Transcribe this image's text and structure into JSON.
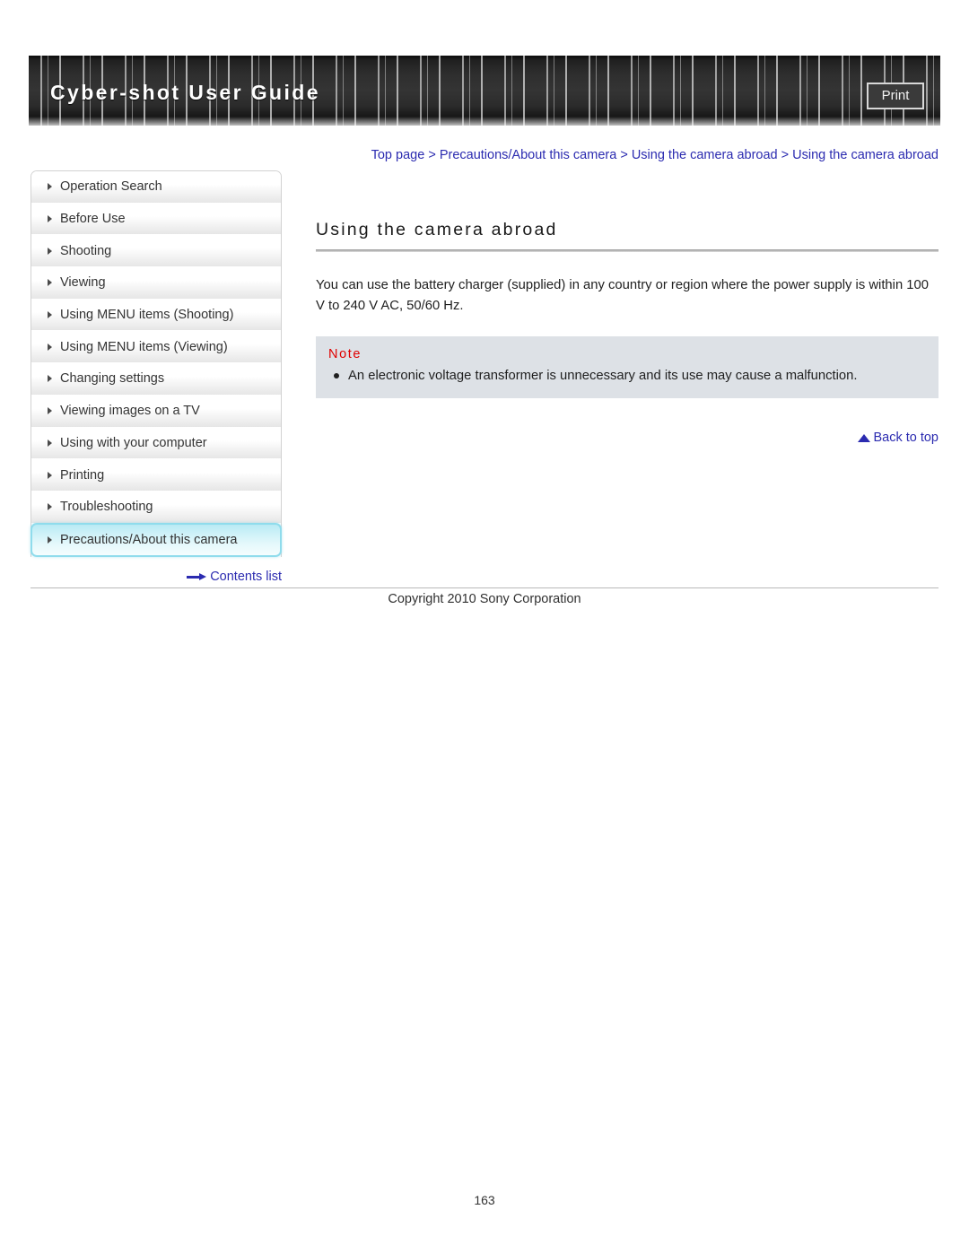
{
  "header": {
    "title": "Cyber-shot User Guide",
    "print_label": "Print"
  },
  "breadcrumb": {
    "full_text": "Top page > Precautions/About this camera > Using the camera abroad > Using the camera abroad",
    "items": [
      "Top page",
      "Precautions/About this camera",
      "Using the camera abroad",
      "Using the camera abroad"
    ],
    "separator": ">",
    "link_color": "#2b2bb0"
  },
  "sidebar": {
    "items": [
      {
        "label": "Operation Search",
        "selected": false
      },
      {
        "label": "Before Use",
        "selected": false
      },
      {
        "label": "Shooting",
        "selected": false
      },
      {
        "label": "Viewing",
        "selected": false
      },
      {
        "label": "Using MENU items (Shooting)",
        "selected": false
      },
      {
        "label": "Using MENU items (Viewing)",
        "selected": false
      },
      {
        "label": "Changing settings",
        "selected": false
      },
      {
        "label": "Viewing images on a TV",
        "selected": false
      },
      {
        "label": "Using with your computer",
        "selected": false
      },
      {
        "label": "Printing",
        "selected": false
      },
      {
        "label": "Troubleshooting",
        "selected": false
      },
      {
        "label": "Precautions/About this camera",
        "selected": true
      }
    ],
    "contents_list_label": "Contents list",
    "selected_bg": "#cdf1f8",
    "selected_border": "#8fdcec"
  },
  "main": {
    "title": "Using the camera abroad",
    "paragraph": "You can use the battery charger (supplied) in any country or region where the power supply is within 100 V to 240 V AC, 50/60 Hz.",
    "note": {
      "label": "Note",
      "label_color": "#e00000",
      "background": "#dde1e6",
      "items": [
        "An electronic voltage transformer is unnecessary and its use may cause a malfunction."
      ]
    },
    "back_to_top_label": "Back to top"
  },
  "footer": {
    "copyright": "Copyright 2010 Sony Corporation",
    "page_number": "163"
  }
}
